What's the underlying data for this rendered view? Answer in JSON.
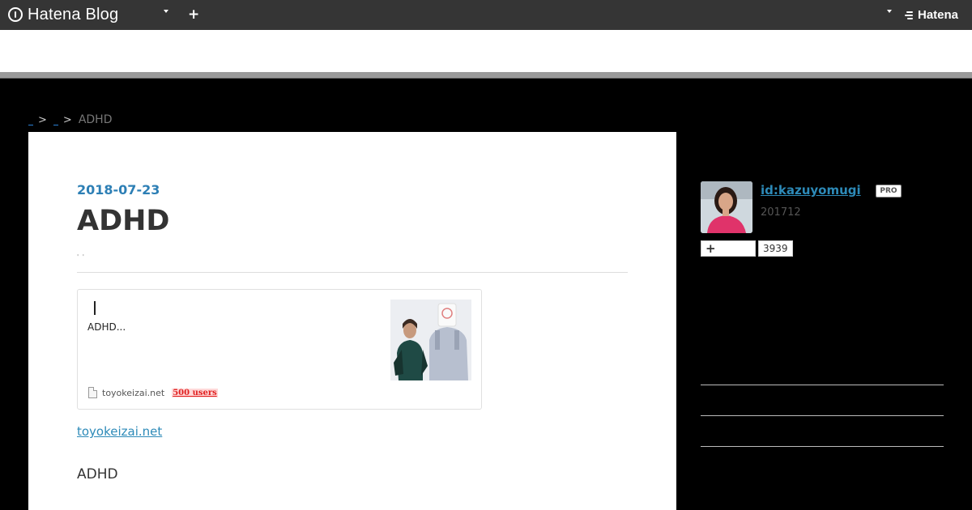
{
  "header": {
    "logo_text": "Hatena Blog",
    "plus_label": "+",
    "right_brand": "Hatena"
  },
  "breadcrumb": {
    "separators": [
      ">",
      ">"
    ],
    "current": "ADHD"
  },
  "article": {
    "date": "2018-07-23",
    "title": "ADHD",
    "subtext": "' '",
    "embed": {
      "title": "ADHD...",
      "domain": "toyokeizai.net",
      "users": "500 users"
    },
    "source_link": "toyokeizai.net",
    "paragraph": "ADHD"
  },
  "sidebar": {
    "username": "id:kazuyomugi",
    "badge": "PRO",
    "since": "201712",
    "follow_label": "+",
    "follower_count": "3939"
  }
}
